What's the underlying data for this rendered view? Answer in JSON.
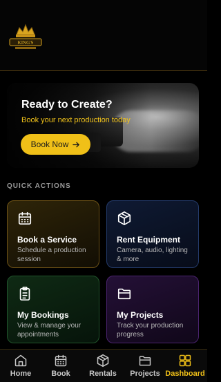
{
  "app": {
    "logo_icon": "crown-logo-icon"
  },
  "hero": {
    "title": "Ready to Create?",
    "subtitle": "Book your next production today",
    "button_label": "Book Now",
    "button_icon": "arrow-right-icon"
  },
  "quick_actions": {
    "title": "QUICK ACTIONS",
    "cards": [
      {
        "title": "Book a Service",
        "description": "Schedule a production session",
        "icon": "calendar-icon"
      },
      {
        "title": "Rent Equipment",
        "description": "Camera, audio, lighting & more",
        "icon": "box-icon"
      },
      {
        "title": "My Bookings",
        "description": "View & manage your appointments",
        "icon": "clipboard-icon"
      },
      {
        "title": "My Projects",
        "description": "Track your production progress",
        "icon": "folder-icon"
      }
    ]
  },
  "tabs": [
    {
      "label": "Home",
      "icon": "home-icon"
    },
    {
      "label": "Book",
      "icon": "calendar-icon"
    },
    {
      "label": "Rentals",
      "icon": "box-icon"
    },
    {
      "label": "Projects",
      "icon": "folder-icon"
    },
    {
      "label": "Dashboard",
      "icon": "grid-icon",
      "active": true
    }
  ],
  "colors": {
    "accent": "#f0c018",
    "background": "#000000"
  }
}
